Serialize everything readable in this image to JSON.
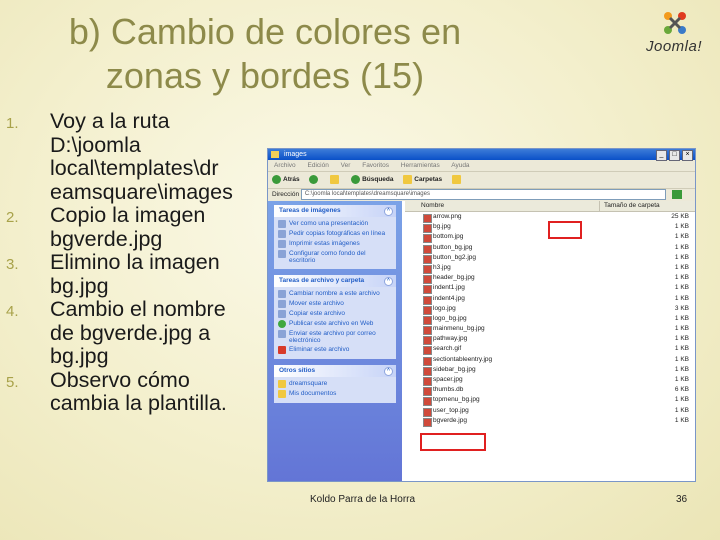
{
  "slide": {
    "title_line1": "b) Cambio de colores en",
    "title_line2": "zonas y bordes (15)",
    "logo_text": "Joomla!",
    "steps": [
      {
        "num": "1.",
        "lines": [
          "Voy a la ruta",
          "D:\\joomla",
          "local\\templates\\dr",
          "eamsquare\\images"
        ]
      },
      {
        "num": "2.",
        "lines": [
          "Copio la imagen",
          "bgverde.jpg"
        ]
      },
      {
        "num": "3.",
        "lines": [
          "Elimino la imagen",
          "bg.jpg"
        ]
      },
      {
        "num": "4.",
        "lines": [
          "Cambio el nombre",
          "de bgverde.jpg a",
          "bg.jpg"
        ]
      },
      {
        "num": "5.",
        "lines": [
          "Observo cómo",
          "cambia la plantilla."
        ]
      }
    ],
    "footer_author": "Koldo Parra de la Horra",
    "page_number": "36"
  },
  "explorer": {
    "window_title": "images",
    "menu": [
      "Archivo",
      "Edición",
      "Ver",
      "Favoritos",
      "Herramientas",
      "Ayuda"
    ],
    "toolbar": {
      "back": "Atrás",
      "search": "Búsqueda",
      "folders": "Carpetas"
    },
    "address_label": "Dirección",
    "address_value": "C:\\joomla local\\templates\\dreamsquare\\images",
    "panes": [
      {
        "title": "Tareas de imágenes",
        "tasks": [
          {
            "icon": "slideshow-icon",
            "label": "Ver como una presentación"
          },
          {
            "icon": "print-order-icon",
            "label": "Pedir copias fotográficas en línea"
          },
          {
            "icon": "printer-icon",
            "label": "Imprimir estas imágenes"
          },
          {
            "icon": "settings-icon",
            "label": "Configurar como fondo del escritorio"
          }
        ]
      },
      {
        "title": "Tareas de archivo y carpeta",
        "tasks": [
          {
            "icon": "rename-icon",
            "label": "Cambiar nombre a este archivo"
          },
          {
            "icon": "move-icon",
            "label": "Mover este archivo"
          },
          {
            "icon": "copy-icon",
            "label": "Copiar este archivo"
          },
          {
            "icon": "web-icon",
            "label": "Publicar este archivo en Web"
          },
          {
            "icon": "email-icon",
            "label": "Enviar este archivo por correo electrónico"
          },
          {
            "icon": "delete-icon",
            "label": "Eliminar este archivo"
          }
        ]
      },
      {
        "title": "Otros sitios",
        "tasks": [
          {
            "icon": "folder-icon",
            "label": "dreamsquare"
          },
          {
            "icon": "folder-icon",
            "label": "Mis documentos"
          }
        ]
      }
    ],
    "columns": {
      "name": "Nombre",
      "size": "Tamaño de carpeta"
    },
    "files": [
      {
        "name": "arrow.png",
        "size": "25 KB"
      },
      {
        "name": "bg.jpg",
        "size": "1 KB"
      },
      {
        "name": "bottom.jpg",
        "size": "1 KB"
      },
      {
        "name": "button_bg.jpg",
        "size": "1 KB"
      },
      {
        "name": "button_bg2.jpg",
        "size": "1 KB"
      },
      {
        "name": "h3.jpg",
        "size": "1 KB"
      },
      {
        "name": "header_bg.jpg",
        "size": "1 KB"
      },
      {
        "name": "indent1.jpg",
        "size": "1 KB"
      },
      {
        "name": "indent4.jpg",
        "size": "1 KB"
      },
      {
        "name": "logo.jpg",
        "size": "3 KB"
      },
      {
        "name": "logo_bg.jpg",
        "size": "1 KB"
      },
      {
        "name": "mainmenu_bg.jpg",
        "size": "1 KB"
      },
      {
        "name": "pathway.jpg",
        "size": "1 KB"
      },
      {
        "name": "search.gif",
        "size": "1 KB"
      },
      {
        "name": "sectiontableentry.jpg",
        "size": "1 KB"
      },
      {
        "name": "sidebar_bg.jpg",
        "size": "1 KB"
      },
      {
        "name": "spacer.jpg",
        "size": "1 KB"
      },
      {
        "name": "thumbs.db",
        "size": "6 KB"
      },
      {
        "name": "topmenu_bg.jpg",
        "size": "1 KB"
      },
      {
        "name": "user_top.jpg",
        "size": "1 KB"
      },
      {
        "name": "bgverde.jpg",
        "size": "1 KB"
      }
    ]
  }
}
